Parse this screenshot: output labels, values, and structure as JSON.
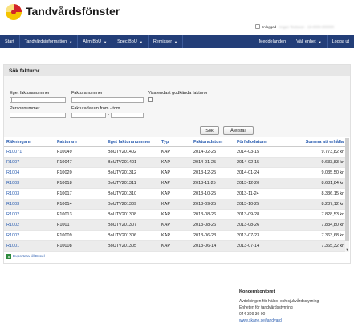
{
  "app": {
    "title": "Tandvårdsfönster",
    "user_label": "Inloggad",
    "user_detail": "Anges Testsson · 19-0000-000000"
  },
  "nav": {
    "items": [
      {
        "label": "Start",
        "dropdown": false
      },
      {
        "label": "Tandvårdsinformation",
        "dropdown": true
      },
      {
        "label": "Allm BoU",
        "dropdown": true
      },
      {
        "label": "Spec BoU",
        "dropdown": true
      },
      {
        "label": "Remisser",
        "dropdown": true
      }
    ],
    "right_items": [
      {
        "label": "Meddelanden",
        "dropdown": false
      },
      {
        "label": "Välj enhet",
        "dropdown": true
      },
      {
        "label": "Logga ut",
        "dropdown": false
      }
    ]
  },
  "panel": {
    "title": "Sök fakturor"
  },
  "search": {
    "own_invoice_label": "Eget fakturanummer",
    "own_invoice_value": "|",
    "invoice_label": "Fakturanummer",
    "invoice_value": "",
    "approved_only_label": "Visa endast godkända fakturor",
    "personal_label": "Personnummer",
    "personal_value": "",
    "date_label": "Fakturadatum from - tom",
    "date_from": "",
    "date_to": "",
    "date_separator": "-",
    "search_button": "Sök",
    "reset_button": "Återställ"
  },
  "table": {
    "columns": [
      "Räkningsnr",
      "Fakturanr",
      "Eget fakturanummer",
      "Typ",
      "Fakturadatum",
      "Förfallodatum",
      "Summa att erhålla"
    ],
    "rows": [
      {
        "rakningsnr": "R10071",
        "fakturanr": "F10049",
        "eget": "BoUTV201402",
        "typ": "KAP",
        "fakturadatum": "2014-02-25",
        "forfallodatum": "2014-03-15",
        "summa": "9.773,82 kr"
      },
      {
        "rakningsnr": "R1007",
        "fakturanr": "F10047",
        "eget": "BoUTV201401",
        "typ": "KAP",
        "fakturadatum": "2014-01-25",
        "forfallodatum": "2014-02-15",
        "summa": "9.633,83 kr"
      },
      {
        "rakningsnr": "R1004",
        "fakturanr": "F10020",
        "eget": "BoUTV201312",
        "typ": "KAP",
        "fakturadatum": "2013-12-25",
        "forfallodatum": "2014-01-24",
        "summa": "9.035,50 kr"
      },
      {
        "rakningsnr": "R1003",
        "fakturanr": "F10018",
        "eget": "BoUTV201311",
        "typ": "KAP",
        "fakturadatum": "2013-11-25",
        "forfallodatum": "2013-12-20",
        "summa": "8.681,84 kr"
      },
      {
        "rakningsnr": "R1003",
        "fakturanr": "F10017",
        "eget": "BoUTV201310",
        "typ": "KAP",
        "fakturadatum": "2013-10-25",
        "forfallodatum": "2013-11-24",
        "summa": "8.336,15 kr"
      },
      {
        "rakningsnr": "R1003",
        "fakturanr": "F10014",
        "eget": "BoUTV201309",
        "typ": "KAP",
        "fakturadatum": "2013-09-25",
        "forfallodatum": "2013-10-25",
        "summa": "8.287,12 kr"
      },
      {
        "rakningsnr": "R1002",
        "fakturanr": "F10013",
        "eget": "BoUTV201308",
        "typ": "KAP",
        "fakturadatum": "2013-08-26",
        "forfallodatum": "2013-09-28",
        "summa": "7.828,53 kr"
      },
      {
        "rakningsnr": "R1002",
        "fakturanr": "F1001",
        "eget": "BoUTV201307",
        "typ": "KAP",
        "fakturadatum": "2013-08-26",
        "forfallodatum": "2013-08-26",
        "summa": "7.834,80 kr"
      },
      {
        "rakningsnr": "R1002",
        "fakturanr": "F10009",
        "eget": "BoUTV201306",
        "typ": "KAP",
        "fakturadatum": "2013-06-23",
        "forfallodatum": "2013-07-23",
        "summa": "7.363,68 kr"
      },
      {
        "rakningsnr": "R1001",
        "fakturanr": "F10008",
        "eget": "BoUTV201305",
        "typ": "KAP",
        "fakturadatum": "2013-06-14",
        "forfallodatum": "2013-07-14",
        "summa": "7.365,32 kr"
      }
    ]
  },
  "export": {
    "label": "Exportera till Excel",
    "icon": "excel-icon"
  },
  "footer": {
    "title": "Koncernkontoret",
    "lines": [
      "Avdelningen för hälso- och sjukvårdsstyrning",
      "Enheten för tandvårdsstyrning",
      "044-309 30 00"
    ],
    "link": "www.skane.se/tandvard"
  },
  "colors": {
    "navbar": "#233e78",
    "link": "#2a5db0",
    "logo_yellow": "#f5c400",
    "logo_red": "#d2232a"
  }
}
